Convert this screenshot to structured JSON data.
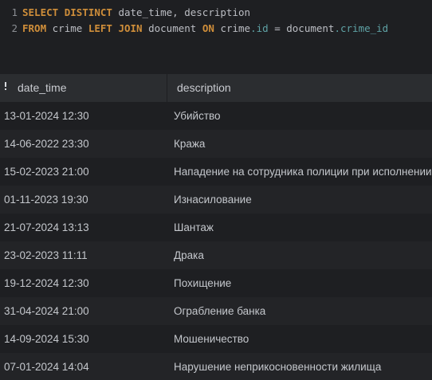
{
  "editor": {
    "lines": [
      {
        "number": "1",
        "tokens": [
          "SELECT",
          "DISTINCT",
          "date_time,",
          "description"
        ]
      },
      {
        "number": "2",
        "tokens": [
          "FROM",
          "crime",
          "LEFT",
          "JOIN",
          "document",
          "ON",
          "crime",
          ".id",
          "=",
          "document",
          ".crime_id"
        ]
      }
    ]
  },
  "grid": {
    "columns": [
      "date_time",
      "description"
    ],
    "rows": [
      [
        "13-01-2024 12:30",
        "Убийство"
      ],
      [
        "14-06-2022 23:30",
        "Кража"
      ],
      [
        "15-02-2023 21:00",
        "Нападение на сотрудника полиции при исполнении"
      ],
      [
        "01-11-2023 19:30",
        "Изнасилование"
      ],
      [
        "21-07-2024 13:13",
        "Шантаж"
      ],
      [
        "23-02-2023 11:11",
        "Драка"
      ],
      [
        "19-12-2024 12:30",
        "Похищение"
      ],
      [
        "31-04-2024 21:00",
        "Ограбление банка"
      ],
      [
        "14-09-2024 15:30",
        "Мошеничество"
      ],
      [
        "07-01-2024 14:04",
        "Нарушение неприкосновенности жилища"
      ]
    ]
  },
  "colors": {
    "background": "#1e1f22",
    "header_background": "#2b2d30",
    "keyword": "#cf8e3a",
    "field": "#5fa2a5",
    "text": "#c4c7cc"
  },
  "icons": {
    "sort": "sort-indicator-icon"
  }
}
